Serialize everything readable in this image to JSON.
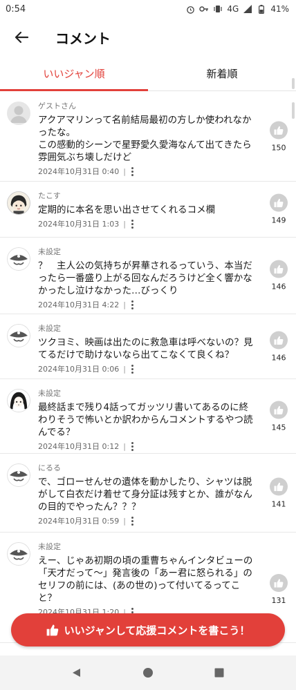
{
  "status_bar": {
    "time": "0:54",
    "network": "4G",
    "battery": "41%"
  },
  "app_bar": {
    "title": "コメント"
  },
  "tabs": [
    {
      "label": "いいジャン順",
      "active": true
    },
    {
      "label": "新着順",
      "active": false
    }
  ],
  "comments": [
    {
      "author": "ゲストさん",
      "avatar": "default-avatar",
      "body": "アクアマリンって名前結局最初の方しか使われなかったな。\nこの感動的シーンで星野愛久愛海なんて出てきたら雰囲気ぶち壊しだけど",
      "date": "2024年10月31日 0:40",
      "likes": "150"
    },
    {
      "author": "たこす",
      "avatar": "anime-avatar-1",
      "body": "定期的に本名を思い出させてくれるコメ欄",
      "date": "2024年10月31日 1:03",
      "likes": "149"
    },
    {
      "author": "未設定",
      "avatar": "pirate-avatar",
      "body": "？　主人公の気持ちが昇華されるっていう、本当だったら一番盛り上がる回なんだろうけど全く響かなかったし泣けなかった…びっくり",
      "date": "2024年10月31日 4:22",
      "likes": "146"
    },
    {
      "author": "未設定",
      "avatar": "pirate-avatar",
      "body": "ツクヨミ、映画は出たのに救急車は呼べないの？見てるだけで助けないなら出てこなくて良くね？",
      "date": "2024年10月31日 0:06",
      "likes": "146"
    },
    {
      "author": "未設定",
      "avatar": "anime-avatar-2",
      "body": "最終話まで残り4話ってガッツリ書いてあるのに終わりそうで怖いとか訳わからんコメントするやつ読んでる？",
      "date": "2024年10月31日 0:12",
      "likes": "145"
    },
    {
      "author": "にるる",
      "avatar": "pirate-avatar",
      "body": "で、ゴローせんせの遺体を動かしたり、シャツは脱がして白衣だけ着せて身分証は残すとか、誰がなんの目的でやったん？？？",
      "date": "2024年10月31日 0:59",
      "likes": "141"
    },
    {
      "author": "未設定",
      "avatar": "pirate-avatar",
      "body": "えー、じゃあ初期の頃の重曹ちゃんインタビューの「天才だって〜」発言後の「あー君に怒られる」のセリフの前には、(あの世の)って付いてるってこと？",
      "date": "2024年10月31日 1:20",
      "likes": "131"
    }
  ],
  "post_button": {
    "label": "いいジャンして応援コメントを書こう！"
  },
  "colors": {
    "accent": "#e2403a",
    "like_bg": "#cfcfcf"
  }
}
